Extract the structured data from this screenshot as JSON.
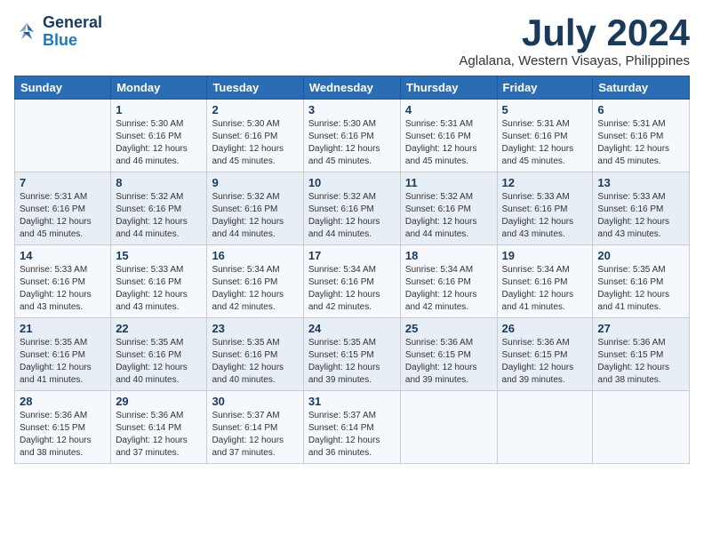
{
  "logo": {
    "line1": "General",
    "line2": "Blue"
  },
  "title": "July 2024",
  "location": "Aglalana, Western Visayas, Philippines",
  "days_header": [
    "Sunday",
    "Monday",
    "Tuesday",
    "Wednesday",
    "Thursday",
    "Friday",
    "Saturday"
  ],
  "weeks": [
    [
      {
        "num": "",
        "info": ""
      },
      {
        "num": "1",
        "info": "Sunrise: 5:30 AM\nSunset: 6:16 PM\nDaylight: 12 hours\nand 46 minutes."
      },
      {
        "num": "2",
        "info": "Sunrise: 5:30 AM\nSunset: 6:16 PM\nDaylight: 12 hours\nand 45 minutes."
      },
      {
        "num": "3",
        "info": "Sunrise: 5:30 AM\nSunset: 6:16 PM\nDaylight: 12 hours\nand 45 minutes."
      },
      {
        "num": "4",
        "info": "Sunrise: 5:31 AM\nSunset: 6:16 PM\nDaylight: 12 hours\nand 45 minutes."
      },
      {
        "num": "5",
        "info": "Sunrise: 5:31 AM\nSunset: 6:16 PM\nDaylight: 12 hours\nand 45 minutes."
      },
      {
        "num": "6",
        "info": "Sunrise: 5:31 AM\nSunset: 6:16 PM\nDaylight: 12 hours\nand 45 minutes."
      }
    ],
    [
      {
        "num": "7",
        "info": "Sunrise: 5:31 AM\nSunset: 6:16 PM\nDaylight: 12 hours\nand 45 minutes."
      },
      {
        "num": "8",
        "info": "Sunrise: 5:32 AM\nSunset: 6:16 PM\nDaylight: 12 hours\nand 44 minutes."
      },
      {
        "num": "9",
        "info": "Sunrise: 5:32 AM\nSunset: 6:16 PM\nDaylight: 12 hours\nand 44 minutes."
      },
      {
        "num": "10",
        "info": "Sunrise: 5:32 AM\nSunset: 6:16 PM\nDaylight: 12 hours\nand 44 minutes."
      },
      {
        "num": "11",
        "info": "Sunrise: 5:32 AM\nSunset: 6:16 PM\nDaylight: 12 hours\nand 44 minutes."
      },
      {
        "num": "12",
        "info": "Sunrise: 5:33 AM\nSunset: 6:16 PM\nDaylight: 12 hours\nand 43 minutes."
      },
      {
        "num": "13",
        "info": "Sunrise: 5:33 AM\nSunset: 6:16 PM\nDaylight: 12 hours\nand 43 minutes."
      }
    ],
    [
      {
        "num": "14",
        "info": "Sunrise: 5:33 AM\nSunset: 6:16 PM\nDaylight: 12 hours\nand 43 minutes."
      },
      {
        "num": "15",
        "info": "Sunrise: 5:33 AM\nSunset: 6:16 PM\nDaylight: 12 hours\nand 43 minutes."
      },
      {
        "num": "16",
        "info": "Sunrise: 5:34 AM\nSunset: 6:16 PM\nDaylight: 12 hours\nand 42 minutes."
      },
      {
        "num": "17",
        "info": "Sunrise: 5:34 AM\nSunset: 6:16 PM\nDaylight: 12 hours\nand 42 minutes."
      },
      {
        "num": "18",
        "info": "Sunrise: 5:34 AM\nSunset: 6:16 PM\nDaylight: 12 hours\nand 42 minutes."
      },
      {
        "num": "19",
        "info": "Sunrise: 5:34 AM\nSunset: 6:16 PM\nDaylight: 12 hours\nand 41 minutes."
      },
      {
        "num": "20",
        "info": "Sunrise: 5:35 AM\nSunset: 6:16 PM\nDaylight: 12 hours\nand 41 minutes."
      }
    ],
    [
      {
        "num": "21",
        "info": "Sunrise: 5:35 AM\nSunset: 6:16 PM\nDaylight: 12 hours\nand 41 minutes."
      },
      {
        "num": "22",
        "info": "Sunrise: 5:35 AM\nSunset: 6:16 PM\nDaylight: 12 hours\nand 40 minutes."
      },
      {
        "num": "23",
        "info": "Sunrise: 5:35 AM\nSunset: 6:16 PM\nDaylight: 12 hours\nand 40 minutes."
      },
      {
        "num": "24",
        "info": "Sunrise: 5:35 AM\nSunset: 6:15 PM\nDaylight: 12 hours\nand 39 minutes."
      },
      {
        "num": "25",
        "info": "Sunrise: 5:36 AM\nSunset: 6:15 PM\nDaylight: 12 hours\nand 39 minutes."
      },
      {
        "num": "26",
        "info": "Sunrise: 5:36 AM\nSunset: 6:15 PM\nDaylight: 12 hours\nand 39 minutes."
      },
      {
        "num": "27",
        "info": "Sunrise: 5:36 AM\nSunset: 6:15 PM\nDaylight: 12 hours\nand 38 minutes."
      }
    ],
    [
      {
        "num": "28",
        "info": "Sunrise: 5:36 AM\nSunset: 6:15 PM\nDaylight: 12 hours\nand 38 minutes."
      },
      {
        "num": "29",
        "info": "Sunrise: 5:36 AM\nSunset: 6:14 PM\nDaylight: 12 hours\nand 37 minutes."
      },
      {
        "num": "30",
        "info": "Sunrise: 5:37 AM\nSunset: 6:14 PM\nDaylight: 12 hours\nand 37 minutes."
      },
      {
        "num": "31",
        "info": "Sunrise: 5:37 AM\nSunset: 6:14 PM\nDaylight: 12 hours\nand 36 minutes."
      },
      {
        "num": "",
        "info": ""
      },
      {
        "num": "",
        "info": ""
      },
      {
        "num": "",
        "info": ""
      }
    ]
  ]
}
